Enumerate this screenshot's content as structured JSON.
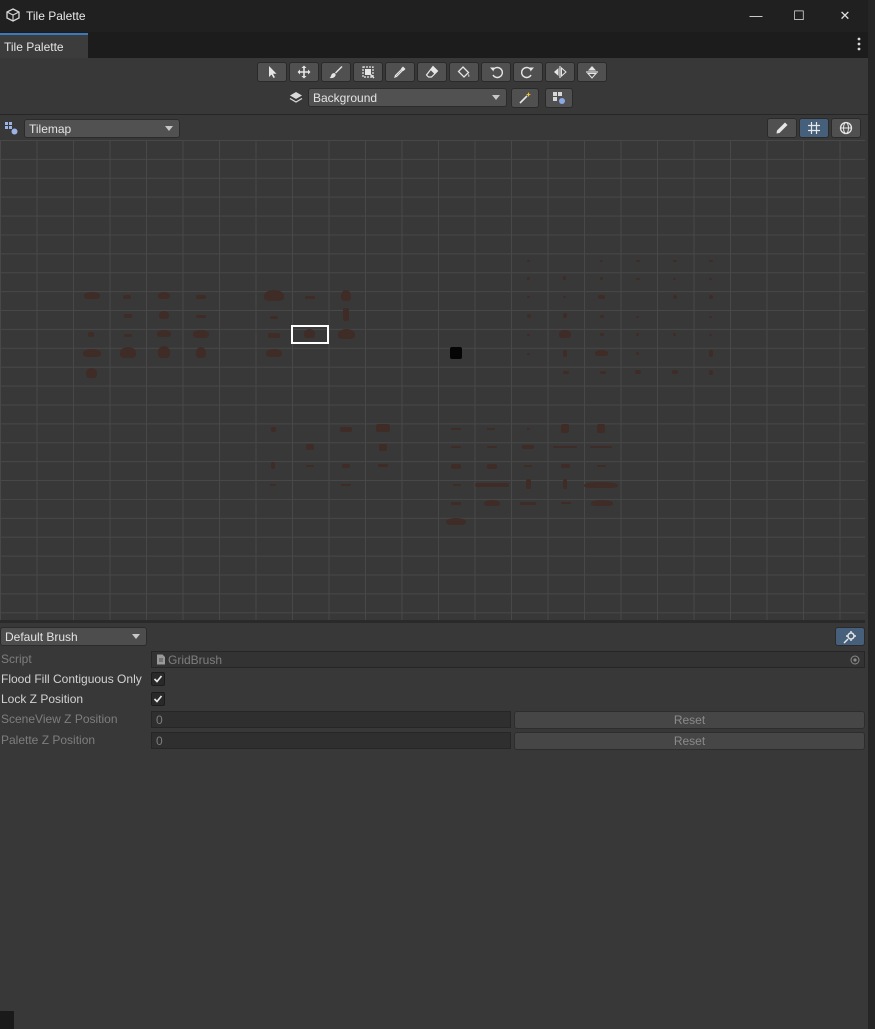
{
  "window": {
    "title": "Tile Palette",
    "minimize": "—",
    "maximize": "☐",
    "close": "✕"
  },
  "tab": {
    "label": "Tile Palette"
  },
  "tools": [
    "select",
    "move",
    "paint",
    "box-fill",
    "picker",
    "erase",
    "flood-fill",
    "rotate-ccw",
    "rotate-cw",
    "flip-x",
    "flip-y"
  ],
  "target": {
    "layer": "Background"
  },
  "palette": {
    "selected": "Tilemap"
  },
  "brush": {
    "selected": "Default Brush",
    "props": {
      "script_label": "Script",
      "script_value": "GridBrush",
      "flood_fill_label": "Flood Fill Contiguous Only",
      "lock_z_label": "Lock Z Position",
      "sceneview_z_label": "SceneView Z Position",
      "sceneview_z_value": "0",
      "palette_z_label": "Palette Z Position",
      "palette_z_value": "0",
      "reset_label": "Reset"
    }
  },
  "colors": {
    "accent": "#3a79bb",
    "panel": "#383838",
    "titlebar": "#202020"
  }
}
